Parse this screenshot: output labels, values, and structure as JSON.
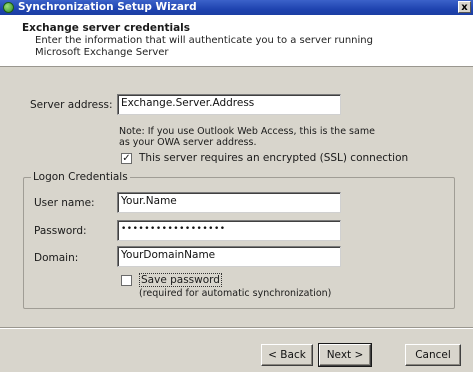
{
  "window": {
    "title": "Synchronization Setup Wizard",
    "close_glyph": "x"
  },
  "header": {
    "title": "Exchange server credentials",
    "subtitle": "Enter the information that will authenticate you to a server running Microsoft Exchange Server"
  },
  "server": {
    "label": "Server address:",
    "value": "Exchange.Server.Address",
    "note": "Note: If you use Outlook Web Access, this is the same as your OWA server address.",
    "ssl_checked": true,
    "ssl_label": "This server requires an encrypted (SSL) connection"
  },
  "logon": {
    "group_label": "Logon Credentials",
    "user_label": "User name:",
    "user_value": "Your.Name",
    "password_label": "Password:",
    "password_value": "••••••••••••••••••",
    "domain_label": "Domain:",
    "domain_value": "YourDomainName",
    "save_checked": false,
    "save_label": "Save password",
    "save_hint": "(required for automatic synchronization)"
  },
  "buttons": {
    "back": "< Back",
    "next": "Next >",
    "cancel": "Cancel"
  },
  "colors": {
    "titlebar": "#1f44b0",
    "dialog_bg": "#d8d5cc",
    "header_bg": "#ffffff"
  }
}
